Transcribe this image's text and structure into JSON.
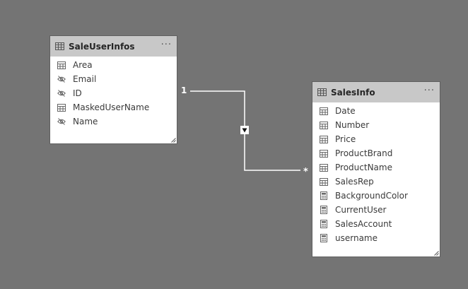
{
  "left_table": {
    "title": "SaleUserInfos",
    "more_label": "···",
    "fields": [
      {
        "name": "Area",
        "icon": "table-column-icon"
      },
      {
        "name": "Email",
        "icon": "hidden-eye-icon"
      },
      {
        "name": "ID",
        "icon": "hidden-eye-icon"
      },
      {
        "name": "MaskedUserName",
        "icon": "table-column-icon"
      },
      {
        "name": "Name",
        "icon": "hidden-eye-icon"
      }
    ]
  },
  "right_table": {
    "title": "SalesInfo",
    "more_label": "···",
    "fields": [
      {
        "name": "Date",
        "icon": "table-column-icon"
      },
      {
        "name": "Number",
        "icon": "table-column-icon"
      },
      {
        "name": "Price",
        "icon": "table-column-icon"
      },
      {
        "name": "ProductBrand",
        "icon": "table-column-icon"
      },
      {
        "name": "ProductName",
        "icon": "table-column-icon"
      },
      {
        "name": "SalesRep",
        "icon": "table-column-icon"
      },
      {
        "name": "BackgroundColor",
        "icon": "calculator-icon"
      },
      {
        "name": "CurrentUser",
        "icon": "calculator-icon"
      },
      {
        "name": "SalesAccount",
        "icon": "calculator-icon"
      },
      {
        "name": "username",
        "icon": "calculator-icon"
      }
    ]
  },
  "relationship": {
    "one_side_label": "1",
    "many_side_label": "*",
    "filter_direction_icon": "filter-arrow-down-icon"
  },
  "colors": {
    "canvas": "#747474",
    "header": "#c8c8c8",
    "line": "#ffffff"
  }
}
